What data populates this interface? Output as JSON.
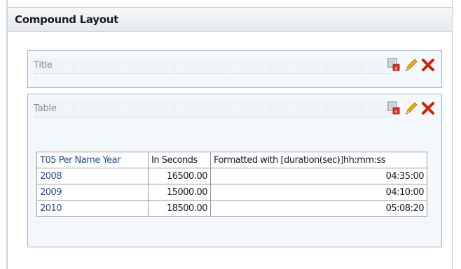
{
  "panel": {
    "title": "Compound Layout"
  },
  "views": [
    {
      "label": "Title"
    },
    {
      "label": "Table"
    }
  ],
  "icons": {
    "properties": "properties-icon",
    "edit": "pencil-icon",
    "delete": "delete-x-icon"
  },
  "table": {
    "headers": [
      "T05 Per Name Year",
      "In Seconds",
      "Formatted with [duration(sec)]hh:mm:ss"
    ],
    "rows": [
      [
        "2008",
        "16500.00",
        "04:35:00"
      ],
      [
        "2009",
        "15000.00",
        "04:10:00"
      ],
      [
        "2010",
        "18500.00",
        "05:08:20"
      ]
    ]
  },
  "colors": {
    "link": "#1f4e9c",
    "view_border": "#9fb3d0",
    "delete_red": "#cc2200",
    "pencil_orange": "#e8a200"
  }
}
